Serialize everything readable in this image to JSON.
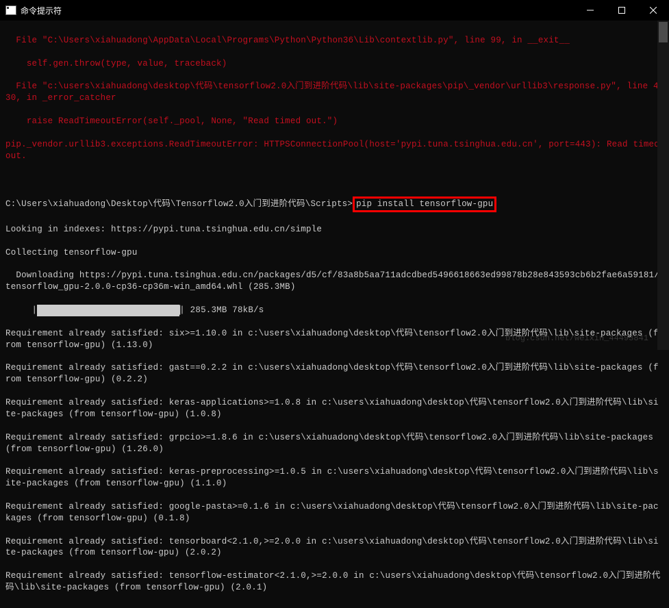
{
  "titlebar": {
    "title": "命令提示符"
  },
  "error_lines": [
    "  File \"C:\\Users\\xiahuadong\\AppData\\Local\\Programs\\Python\\Python36\\Lib\\contextlib.py\", line 99, in __exit__",
    "    self.gen.throw(type, value, traceback)",
    "  File \"c:\\users\\xiahuadong\\desktop\\代码\\tensorflow2.0入门到进阶代码\\lib\\site-packages\\pip\\_vendor\\urllib3\\response.py\", line 430, in _error_catcher",
    "    raise ReadTimeoutError(self._pool, None, \"Read timed out.\")",
    "pip._vendor.urllib3.exceptions.ReadTimeoutError: HTTPSConnectionPool(host='pypi.tuna.tsinghua.edu.cn', port=443): Read timed out."
  ],
  "prompt_line": {
    "prefix": "C:\\Users\\xiahuadong\\Desktop\\代码\\Tensorflow2.0入门到进阶代码\\Scripts>",
    "command": "pip install tensorflow-gpu"
  },
  "output_lines": [
    "Looking in indexes: https://pypi.tuna.tsinghua.edu.cn/simple",
    "Collecting tensorflow-gpu",
    "  Downloading https://pypi.tuna.tsinghua.edu.cn/packages/d5/cf/83a8b5aa711adcdbed5496618663ed99878b28e843593cb6b2fae6a59181/tensorflow_gpu-2.0.0-cp36-cp36m-win_amd64.whl (285.3MB)"
  ],
  "progress": {
    "bar_fill": "████████████████████████████████",
    "status": "| 285.3MB 78kB/s"
  },
  "requirement_lines": [
    "Requirement already satisfied: six>=1.10.0 in c:\\users\\xiahuadong\\desktop\\代码\\tensorflow2.0入门到进阶代码\\lib\\site-packages (from tensorflow-gpu) (1.13.0)",
    "Requirement already satisfied: gast==0.2.2 in c:\\users\\xiahuadong\\desktop\\代码\\tensorflow2.0入门到进阶代码\\lib\\site-packages (from tensorflow-gpu) (0.2.2)",
    "Requirement already satisfied: keras-applications>=1.0.8 in c:\\users\\xiahuadong\\desktop\\代码\\tensorflow2.0入门到进阶代码\\lib\\site-packages (from tensorflow-gpu) (1.0.8)",
    "Requirement already satisfied: grpcio>=1.8.6 in c:\\users\\xiahuadong\\desktop\\代码\\tensorflow2.0入门到进阶代码\\lib\\site-packages (from tensorflow-gpu) (1.26.0)",
    "Requirement already satisfied: keras-preprocessing>=1.0.5 in c:\\users\\xiahuadong\\desktop\\代码\\tensorflow2.0入门到进阶代码\\lib\\site-packages (from tensorflow-gpu) (1.1.0)",
    "Requirement already satisfied: google-pasta>=0.1.6 in c:\\users\\xiahuadong\\desktop\\代码\\tensorflow2.0入门到进阶代码\\lib\\site-packages (from tensorflow-gpu) (0.1.8)",
    "Requirement already satisfied: tensorboard<2.1.0,>=2.0.0 in c:\\users\\xiahuadong\\desktop\\代码\\tensorflow2.0入门到进阶代码\\lib\\site-packages (from tensorflow-gpu) (2.0.2)",
    "Requirement already satisfied: tensorflow-estimator<2.1.0,>=2.0.0 in c:\\users\\xiahuadong\\desktop\\代码\\tensorflow2.0入门到进阶代码\\lib\\site-packages (from tensorflow-gpu) (2.0.1)"
  ],
  "watermark": "blog.csdn.net/weixin_44493841"
}
